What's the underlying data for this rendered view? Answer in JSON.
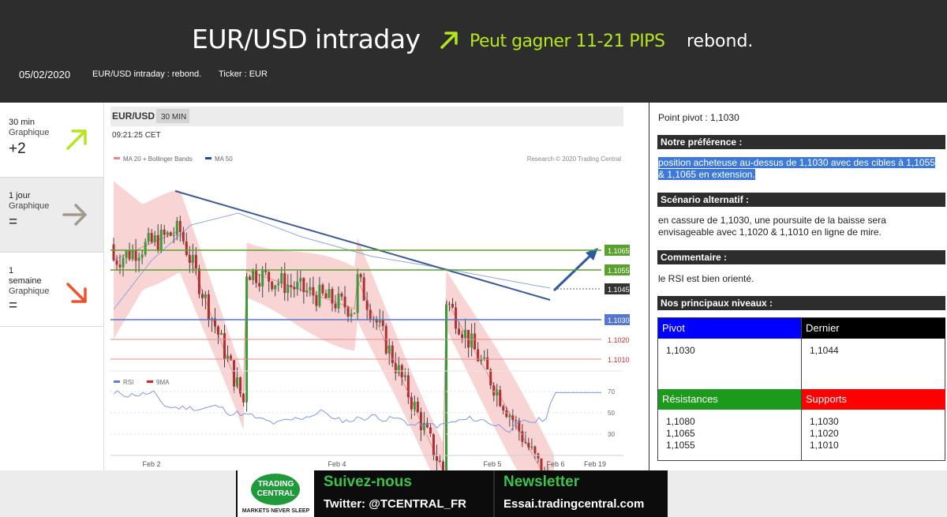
{
  "header": {
    "title": "EUR/USD intraday",
    "pips": "Peut gagner 11-21 PIPS",
    "direction": "rebond.",
    "date": "05/02/2020",
    "subtitle": "EUR/USD intraday : rebond.",
    "ticker": "Ticker : EUR",
    "arrow_color": "#b5e61d"
  },
  "timeframes": [
    {
      "line1": "30 min",
      "line2": "Graphique",
      "score": "+2",
      "icon": "arrow-up-right-icon",
      "color": "#b5e61d"
    },
    {
      "line1": "1 jour",
      "line2": "Graphique",
      "score": "=",
      "icon": "arrow-right-icon",
      "color": "#a39a8e"
    },
    {
      "line1": "1",
      "line1b": "semaine",
      "line2": "Graphique",
      "score": "=",
      "icon": "arrow-down-right-icon",
      "color": "#f0502a"
    }
  ],
  "chart": {
    "symbol": "EUR/USD",
    "interval": "30 MIN",
    "time": "09:21:25 CET",
    "legend_ma20": "MA 20 + Bollinger Bands",
    "legend_ma50": "MA 50",
    "copyright": "Research © 2020 Trading Central",
    "rsi_legend": "RSI",
    "rsi_ma_legend": "9MA",
    "levels": [
      {
        "label": "1.1065",
        "value": 1.1065,
        "kind": "resistance"
      },
      {
        "label": "1.1055",
        "value": 1.1055,
        "kind": "resistance"
      },
      {
        "label": "1.1045",
        "value": 1.1045,
        "kind": "last"
      },
      {
        "label": "1.1030",
        "value": 1.103,
        "kind": "pivot"
      },
      {
        "label": "1.1020",
        "value": 1.102,
        "kind": "support"
      },
      {
        "label": "1.1010",
        "value": 1.101,
        "kind": "support"
      }
    ],
    "rsi_ticks": [
      "70",
      "50",
      "30"
    ],
    "x_ticks": [
      "Feb 2",
      "Feb 4",
      "Feb 5",
      "Feb 6",
      "Feb 19"
    ]
  },
  "chart_data": {
    "type": "line",
    "xlabel": "",
    "ylabel": "",
    "ylim": [
      1.1,
      1.11
    ],
    "x": [
      "Feb 2",
      "Feb 4",
      "Feb 5",
      "Feb 6"
    ],
    "series": [
      {
        "name": "EUR/USD",
        "values": [
          1.1075,
          1.106,
          1.104,
          1.1026,
          1.1045
        ]
      },
      {
        "name": "MA 50",
        "values": [
          1.104,
          1.1075,
          1.1055,
          1.1045,
          1.104
        ]
      }
    ],
    "rsi": {
      "ticks": [
        70,
        50,
        30
      ]
    }
  },
  "panel": {
    "pivot": "Point pivot : 1,1030",
    "pref_head": "Notre préférence :",
    "pref_text": "position acheteuse au-dessus de 1,1030 avec des cibles à 1,1055 & 1,1065 en extension.",
    "alt_head": "Scénario alternatif :",
    "alt_text": "en cassure de 1,1030, une poursuite de la baisse sera envisageable avec 1,1020 & 1,1010 en ligne de mire.",
    "comment_head": "Commentaire :",
    "comment_text": "le RSI est bien orienté.",
    "levels_head": "Nos principaux niveaux :",
    "pivot_label": "Pivot",
    "pivot_value": "1,1030",
    "last_label": "Dernier",
    "last_value": "1,1044",
    "res_label": "Résistances",
    "res_values": [
      "1,1080",
      "1,1065",
      "1,1055"
    ],
    "sup_label": "Supports",
    "sup_values": [
      "1,1030",
      "1,1020",
      "1,1010"
    ],
    "colors": {
      "pivot": "#0000ff",
      "last": "#000000",
      "res": "#1c9a1c",
      "sup": "#ff0000"
    }
  },
  "footer": {
    "logo_line1": "TRADING",
    "logo_line2": "CENTRAL",
    "logo_tag": "MARKETS NEVER SLEEP",
    "follow_head": "Suivez-nous",
    "follow_sub": "Twitter: @TCENTRAL_FR",
    "news_head": "Newsletter",
    "news_sub": "Essai.tradingcentral.com"
  }
}
